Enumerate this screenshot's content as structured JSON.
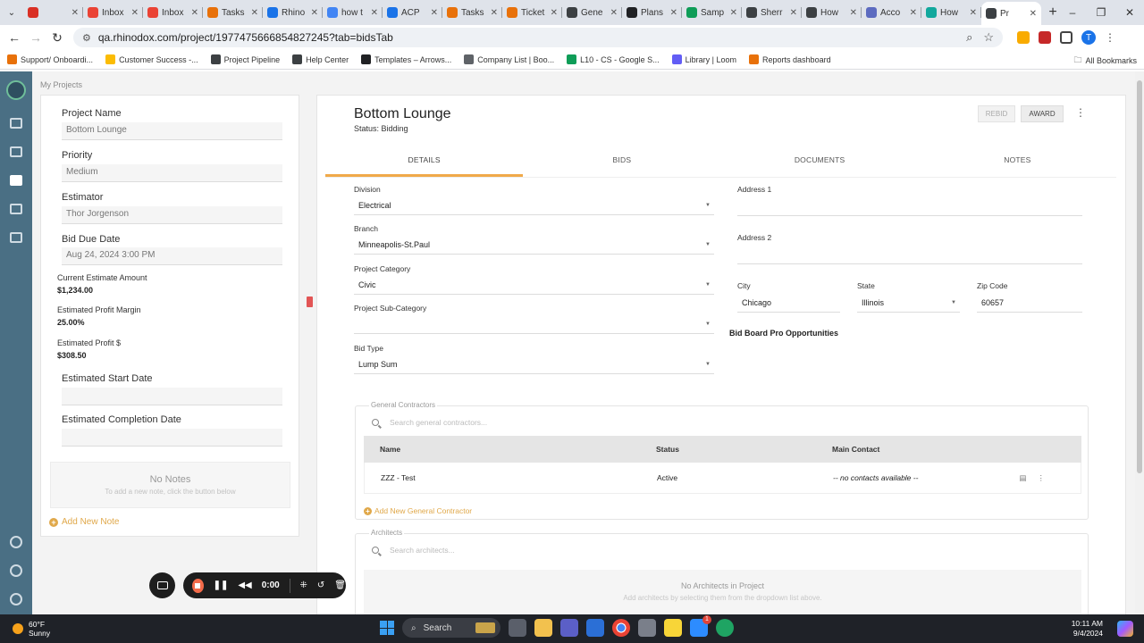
{
  "browser": {
    "tabs": [
      {
        "title": "",
        "color": "#d93025"
      },
      {
        "title": "Inbox",
        "color": "#ea4335"
      },
      {
        "title": "Inbox",
        "color": "#ea4335"
      },
      {
        "title": "Tasks",
        "color": "#e8710a"
      },
      {
        "title": "Rhino",
        "color": "#1a73e8"
      },
      {
        "title": "how t",
        "color": "#4285f4"
      },
      {
        "title": "ACP",
        "color": "#1a73e8"
      },
      {
        "title": "Tasks",
        "color": "#e8710a"
      },
      {
        "title": "Ticket",
        "color": "#e8710a"
      },
      {
        "title": "Gene",
        "color": "#3c4043"
      },
      {
        "title": "Plans",
        "color": "#202124"
      },
      {
        "title": "Samp",
        "color": "#0f9d58"
      },
      {
        "title": "Sherr",
        "color": "#3c4043"
      },
      {
        "title": "How",
        "color": "#3c4043"
      },
      {
        "title": "Acco",
        "color": "#5c6bc0"
      },
      {
        "title": "How",
        "color": "#12a89d"
      },
      {
        "title": "Pr",
        "color": "#3c4043",
        "active": true
      }
    ],
    "url": "qa.rhinodox.com/project/1977475666854827245?tab=bidsTab",
    "bookmarks": [
      {
        "label": "Support/ Onboardi...",
        "color": "#e8710a"
      },
      {
        "label": "Customer Success -...",
        "color": "#fbbc04"
      },
      {
        "label": "Project Pipeline",
        "color": "#3c4043"
      },
      {
        "label": "Help Center",
        "color": "#3c4043"
      },
      {
        "label": "Templates – Arrows...",
        "color": "#202124"
      },
      {
        "label": "Company List | Boo...",
        "color": "#5f6368"
      },
      {
        "label": "L10 - CS - Google S...",
        "color": "#0f9d58"
      },
      {
        "label": "Library | Loom",
        "color": "#625df5"
      },
      {
        "label": "Reports dashboard",
        "color": "#e8710a"
      }
    ],
    "all_bookmarks": "All Bookmarks",
    "profile_initial": "T"
  },
  "app": {
    "breadcrumb": "My Projects",
    "left": {
      "project_name_label": "Project Name",
      "project_name": "Bottom Lounge",
      "priority_label": "Priority",
      "priority": "Medium",
      "estimator_label": "Estimator",
      "estimator": "Thor Jorgenson",
      "bid_due_label": "Bid Due Date",
      "bid_due": "Aug 24, 2024 3:00 PM",
      "current_estimate_label": "Current Estimate Amount",
      "current_estimate": "$1,234.00",
      "profit_margin_label": "Estimated Profit Margin",
      "profit_margin": "25.00%",
      "profit_label": "Estimated Profit $",
      "profit": "$308.50",
      "start_date_label": "Estimated Start Date",
      "start_date": "",
      "completion_date_label": "Estimated Completion Date",
      "completion_date": "",
      "no_notes": "No Notes",
      "no_notes_hint": "To add a new note, click the button below",
      "add_note": "Add New Note"
    },
    "main": {
      "title": "Bottom Lounge",
      "status": "Status: Bidding",
      "rebid": "REBID",
      "award": "AWARD",
      "tabs": [
        "DETAILS",
        "BIDS",
        "DOCUMENTS",
        "NOTES"
      ],
      "division_label": "Division",
      "division": "Electrical",
      "branch_label": "Branch",
      "branch": "Minneapolis-St.Paul",
      "category_label": "Project Category",
      "category": "Civic",
      "subcategory_label": "Project Sub-Category",
      "subcategory": "",
      "bidtype_label": "Bid Type",
      "bidtype": "Lump Sum",
      "address1_label": "Address 1",
      "address1": "",
      "address2_label": "Address 2",
      "address2": "",
      "city_label": "City",
      "city": "Chicago",
      "state_label": "State",
      "state": "Illinois",
      "zip_label": "Zip Code",
      "zip": "60657",
      "bidboard": "Bid Board Pro Opportunities",
      "gc": {
        "legend": "General Contractors",
        "search_placeholder": "Search general contractors...",
        "columns": [
          "Name",
          "Status",
          "Main Contact"
        ],
        "rows": [
          {
            "name": "ZZZ - Test",
            "status": "Active",
            "contact": "-- no contacts available --"
          }
        ],
        "add": "Add New General Contractor"
      },
      "architects": {
        "legend": "Architects",
        "search_placeholder": "Search architects...",
        "empty": "No Architects in Project",
        "empty_hint": "Add architects by selecting them from the dropdown list above."
      }
    }
  },
  "recorder": {
    "time": "0:00"
  },
  "taskbar": {
    "temp": "60°F",
    "condition": "Sunny",
    "search": "Search",
    "time": "10:11 AM",
    "date": "9/4/2024",
    "badge": "1"
  }
}
